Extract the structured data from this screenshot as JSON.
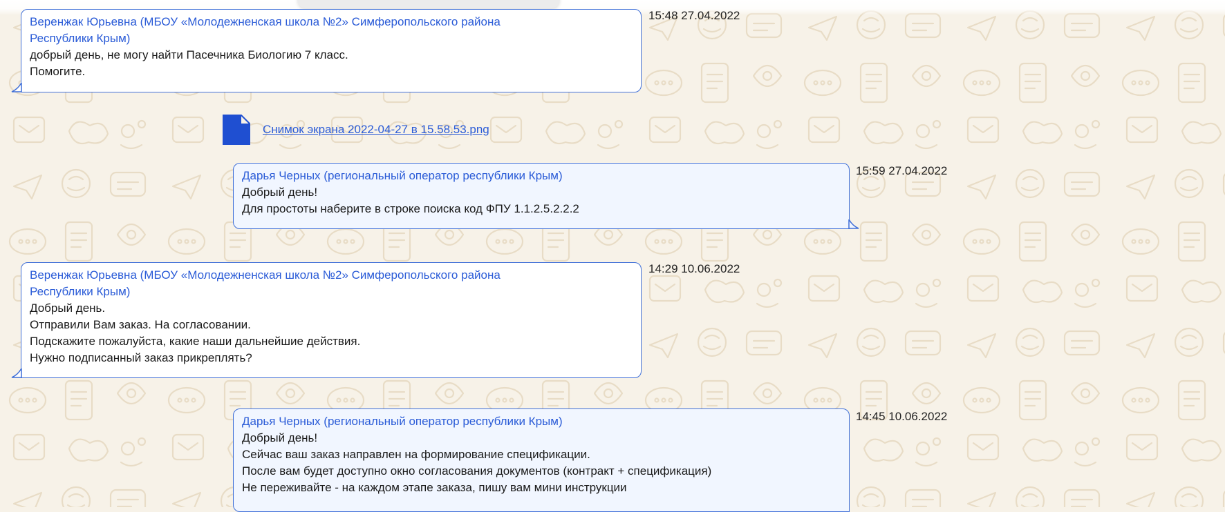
{
  "colors": {
    "background": "#f7f2e8",
    "bubble_border": "#3f6fd8",
    "author": "#2a5bd7",
    "file_icon": "#1f4fd1"
  },
  "messages": [
    {
      "author_lines": [
        "Веренжак Юрьевна (МБОУ «Молодежненская школа №2» Симферопольского района",
        "Республики Крым)"
      ],
      "text_lines": [
        "добрый день, не могу найти Пасечника Биологию 7 класс.",
        "Помогите."
      ],
      "timestamp": "15:48 27.04.2022"
    },
    {
      "attachment_icon": "file-icon",
      "attachment_name": "Снимок экрана 2022-04-27 в 15.58.53.png"
    },
    {
      "author_lines": [
        "Дарья Черных (региональный оператор республики Крым)"
      ],
      "text_lines": [
        "Добрый день!",
        "Для простоты наберите в строке поиска код ФПУ 1.1.2.5.2.2.2"
      ],
      "timestamp": "15:59 27.04.2022"
    },
    {
      "author_lines": [
        "Веренжак Юрьевна (МБОУ «Молодежненская школа №2» Симферопольского района",
        "Республики Крым)"
      ],
      "text_lines": [
        "Добрый день.",
        "Отправили Вам заказ. На согласовании.",
        "Подскажите пожалуйста, какие наши дальнейшие действия.",
        "Нужно подписанный заказ прикреплять?"
      ],
      "timestamp": "14:29 10.06.2022"
    },
    {
      "author_lines": [
        "Дарья Черных (региональный оператор республики Крым)"
      ],
      "text_lines": [
        "Добрый день!",
        "Сейчас ваш заказ направлен на формирование спецификации.",
        "После вам будет доступно окно согласования документов (контракт + спецификация)",
        "Не переживайте - на каждом этапе заказа, пишу вам мини инструкции"
      ],
      "timestamp": "14:45 10.06.2022"
    }
  ]
}
